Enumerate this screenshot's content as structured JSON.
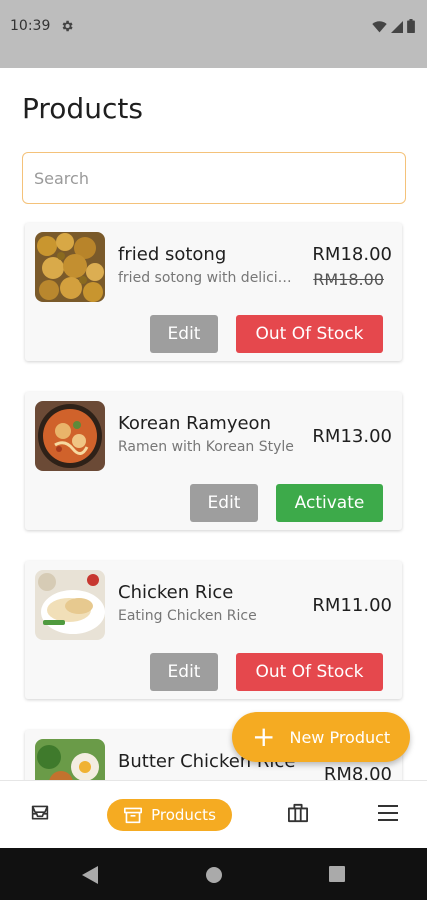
{
  "status": {
    "time": "10:39"
  },
  "page": {
    "title": "Products"
  },
  "search": {
    "placeholder": "Search"
  },
  "products": [
    {
      "name": "fried sotong",
      "description": "fried sotong with delicious ...",
      "price": "RM18.00",
      "old_price": "RM18.00",
      "edit_label": "Edit",
      "action_label": "Out Of Stock",
      "action_color": "#e5484d"
    },
    {
      "name": "Korean Ramyeon",
      "description": "Ramen with Korean Style",
      "price": "RM13.00",
      "edit_label": "Edit",
      "action_label": "Activate",
      "action_color": "#3daa4a"
    },
    {
      "name": "Chicken Rice",
      "description": "Eating Chicken Rice",
      "price": "RM11.00",
      "edit_label": "Edit",
      "action_label": "Out Of Stock",
      "action_color": "#e5484d"
    },
    {
      "name": "Butter Chicken Rice",
      "price": "RM8.00"
    }
  ],
  "fab": {
    "label": "New Product"
  },
  "nav": {
    "active_label": "Products"
  },
  "colors": {
    "accent": "#f5ab22",
    "danger": "#e5484d",
    "success": "#3daa4a",
    "muted_button": "#9e9e9e"
  }
}
